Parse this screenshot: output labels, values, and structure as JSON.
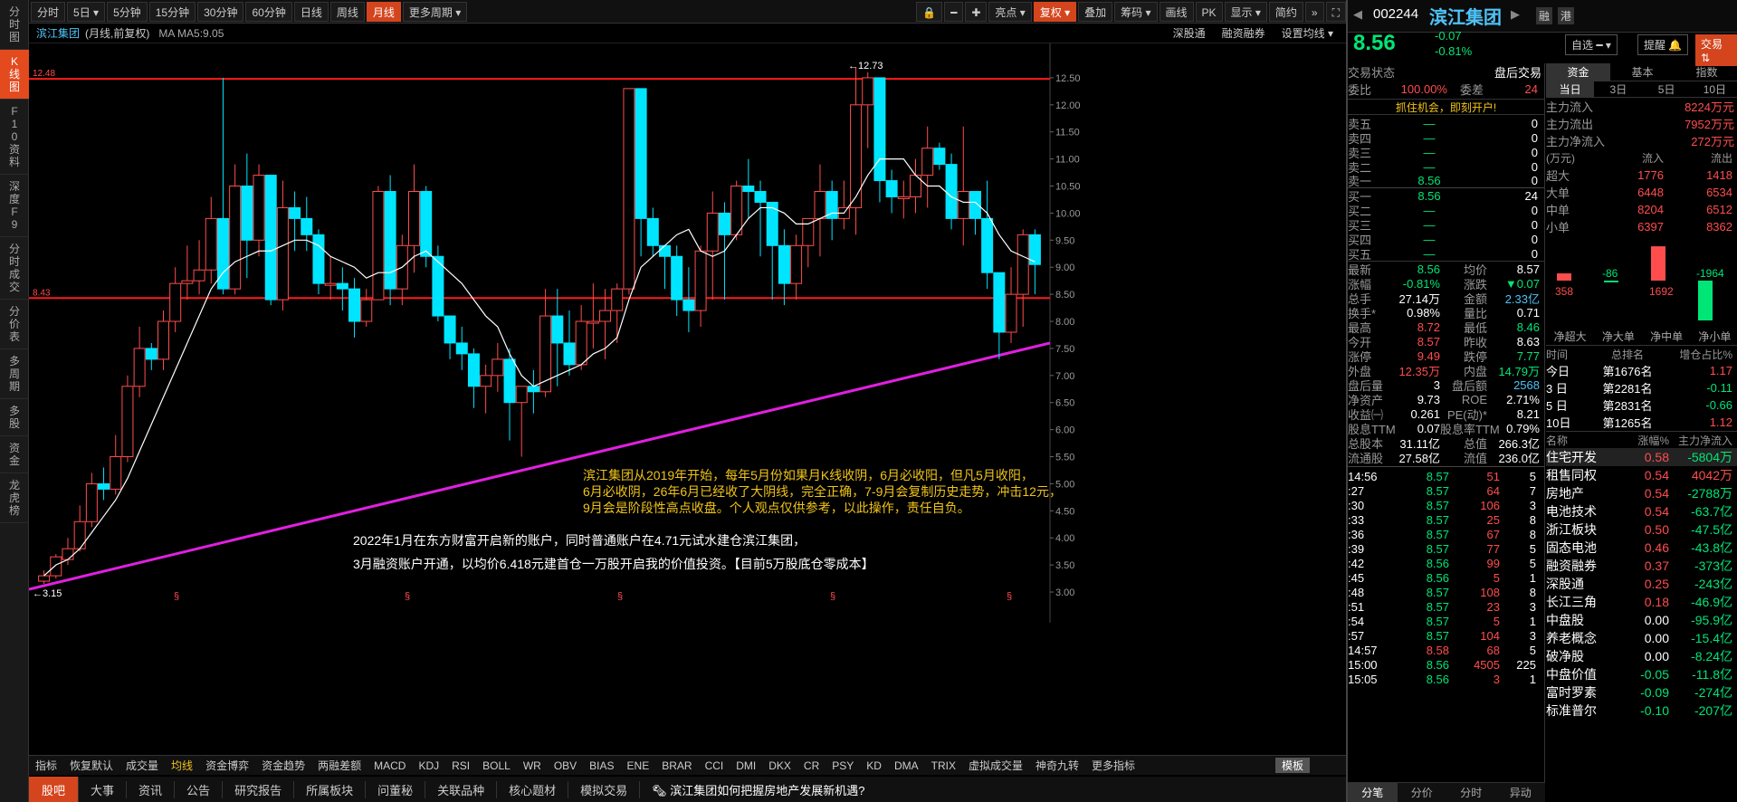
{
  "sidebar": [
    "分时图",
    "K线图",
    "F10资料",
    "深度F9",
    "分时成交",
    "分价表",
    "多周期",
    "多股",
    "资金",
    "龙虎榜"
  ],
  "toolbar": {
    "periods": [
      "分时",
      "5日",
      "5分钟",
      "15分钟",
      "30分钟",
      "60分钟",
      "日线",
      "周线",
      "月线",
      "更多周期"
    ],
    "right": [
      "亮点",
      "复权",
      "叠加",
      "筹码",
      "画线",
      "PK",
      "显示",
      "简约"
    ]
  },
  "sub": {
    "name": "滨江集团",
    "mode": "(月线,前复权)",
    "ma": "MA  MA5:9.05",
    "right": [
      "深股通",
      "融资融券",
      "设置均线"
    ]
  },
  "chart_data": {
    "type": "candlestick",
    "ylim": [
      2.9,
      12.9
    ],
    "yticks": [
      "12.50",
      "12.00",
      "11.50",
      "11.00",
      "10.50",
      "10.00",
      "9.50",
      "9.00",
      "8.50",
      "8.00",
      "7.50",
      "7.00",
      "6.50",
      "6.00",
      "5.50",
      "5.00",
      "4.50",
      "4.00",
      "3.50",
      "3.00"
    ],
    "hlines": [
      {
        "label": "12.48",
        "value": 12.48
      },
      {
        "label": "8.43",
        "value": 8.43
      }
    ],
    "marks": {
      "high": "12.73",
      "low": "3.15"
    },
    "candles": [
      [
        3.2,
        3.3,
        3.15,
        3.4
      ],
      [
        3.3,
        3.65,
        3.25,
        3.7
      ],
      [
        3.6,
        3.8,
        3.5,
        4.0
      ],
      [
        3.8,
        4.3,
        3.75,
        4.6
      ],
      [
        4.3,
        5.0,
        4.2,
        5.2
      ],
      [
        5.0,
        4.9,
        4.7,
        5.3
      ],
      [
        4.9,
        5.5,
        4.8,
        5.9
      ],
      [
        5.5,
        6.8,
        5.4,
        7.0
      ],
      [
        6.8,
        7.5,
        6.6,
        7.9
      ],
      [
        7.5,
        7.3,
        7.1,
        7.6
      ],
      [
        7.3,
        8.0,
        7.1,
        8.2
      ],
      [
        8.0,
        8.7,
        7.8,
        9.0
      ],
      [
        8.7,
        8.75,
        8.4,
        9.4
      ],
      [
        8.75,
        8.95,
        8.5,
        9.5
      ],
      [
        8.95,
        9.9,
        8.7,
        10.3
      ],
      [
        9.9,
        8.6,
        8.5,
        12.5
      ],
      [
        8.6,
        10.5,
        8.5,
        10.9
      ],
      [
        10.5,
        9.5,
        8.8,
        11.1
      ],
      [
        9.5,
        10.7,
        9.2,
        10.9
      ],
      [
        10.7,
        8.4,
        8.3,
        10.7
      ],
      [
        8.4,
        10.1,
        8.2,
        10.6
      ],
      [
        10.1,
        9.9,
        9.3,
        10.4
      ],
      [
        9.9,
        9.6,
        9.3,
        10.3
      ],
      [
        9.6,
        8.7,
        8.5,
        9.7
      ],
      [
        8.7,
        8.7,
        8.4,
        9.2
      ],
      [
        8.7,
        8.6,
        8.2,
        9.0
      ],
      [
        8.6,
        8.0,
        7.7,
        8.8
      ],
      [
        8.0,
        8.4,
        7.9,
        8.6
      ],
      [
        8.4,
        10.4,
        8.4,
        10.5
      ],
      [
        10.4,
        8.6,
        8.3,
        10.7
      ],
      [
        8.6,
        9.4,
        8.3,
        9.6
      ],
      [
        9.4,
        10.4,
        8.9,
        10.9
      ],
      [
        10.4,
        9.2,
        9.0,
        10.5
      ],
      [
        9.2,
        8.1,
        8.0,
        9.4
      ],
      [
        8.1,
        7.6,
        7.3,
        7.7
      ],
      [
        7.6,
        7.4,
        7.1,
        7.9
      ],
      [
        7.4,
        6.8,
        6.4,
        7.5
      ],
      [
        6.8,
        7.0,
        6.3,
        7.2
      ],
      [
        7.0,
        7.3,
        6.7,
        7.6
      ],
      [
        7.3,
        6.5,
        5.8,
        7.5
      ],
      [
        6.5,
        6.8,
        5.5,
        6.8
      ],
      [
        6.8,
        6.7,
        6.3,
        7.1
      ],
      [
        6.7,
        8.1,
        6.6,
        8.6
      ],
      [
        8.1,
        7.6,
        6.8,
        8.6
      ],
      [
        7.6,
        7.2,
        7.0,
        8.2
      ],
      [
        7.2,
        8.0,
        7.1,
        8.3
      ],
      [
        8.0,
        8.0,
        7.5,
        8.7
      ],
      [
        8.0,
        8.2,
        7.3,
        8.6
      ],
      [
        8.2,
        8.6,
        7.6,
        8.7
      ],
      [
        8.6,
        12.3,
        8.5,
        12.3
      ],
      [
        12.3,
        9.9,
        9.2,
        12.3
      ],
      [
        9.9,
        9.4,
        9.2,
        10.1
      ],
      [
        9.4,
        9.2,
        8.6,
        9.4
      ],
      [
        9.2,
        8.4,
        8.1,
        9.4
      ],
      [
        8.4,
        8.2,
        7.8,
        9.0
      ],
      [
        8.2,
        9.3,
        7.9,
        9.4
      ],
      [
        9.3,
        10.0,
        8.4,
        10.4
      ],
      [
        10.0,
        9.6,
        8.4,
        10.2
      ],
      [
        9.6,
        10.5,
        9.5,
        10.6
      ],
      [
        10.5,
        10.4,
        9.9,
        11.0
      ],
      [
        10.4,
        10.2,
        9.2,
        10.6
      ],
      [
        10.2,
        9.4,
        8.4,
        10.2
      ],
      [
        9.4,
        8.7,
        8.3,
        9.7
      ],
      [
        8.7,
        9.4,
        8.4,
        9.6
      ],
      [
        9.4,
        9.9,
        9.0,
        9.9
      ],
      [
        9.9,
        10.4,
        9.2,
        10.9
      ],
      [
        10.4,
        9.9,
        9.5,
        10.6
      ],
      [
        9.9,
        10.1,
        9.7,
        10.6
      ],
      [
        10.1,
        12.0,
        9.6,
        12.7
      ],
      [
        12.0,
        12.5,
        11.2,
        12.6
      ],
      [
        12.5,
        10.6,
        10.2,
        12.5
      ],
      [
        10.6,
        10.3,
        10.0,
        10.8
      ],
      [
        10.3,
        10.3,
        9.9,
        10.6
      ],
      [
        10.3,
        10.7,
        10.0,
        11.0
      ],
      [
        10.7,
        11.2,
        10.1,
        11.6
      ],
      [
        11.2,
        10.9,
        10.8,
        11.3
      ],
      [
        10.9,
        9.9,
        9.7,
        11.1
      ],
      [
        9.9,
        10.4,
        9.4,
        11.6
      ],
      [
        10.4,
        9.9,
        9.6,
        10.3
      ],
      [
        9.9,
        8.9,
        8.6,
        10.6
      ],
      [
        8.9,
        7.8,
        7.3,
        8.9
      ],
      [
        7.8,
        8.5,
        7.6,
        9.0
      ],
      [
        8.5,
        9.6,
        7.9,
        9.7
      ],
      [
        9.6,
        9.05,
        8.5,
        9.7
      ]
    ],
    "ma5": [
      3.3,
      3.5,
      3.6,
      3.8,
      4.1,
      4.4,
      4.7,
      5.1,
      5.6,
      6.1,
      6.6,
      7.1,
      7.6,
      8.1,
      8.6,
      8.9,
      9.1,
      9.2,
      9.3,
      9.3,
      9.4,
      9.5,
      9.5,
      9.4,
      9.2,
      9.1,
      9.0,
      8.8,
      8.9,
      8.9,
      9.0,
      9.2,
      9.3,
      9.1,
      8.9,
      8.7,
      8.4,
      8.1,
      7.9,
      7.4,
      7.0,
      6.8,
      6.9,
      7.0,
      7.1,
      7.2,
      7.4,
      7.5,
      7.7,
      8.4,
      9.0,
      9.2,
      9.4,
      9.6,
      9.7,
      9.3,
      9.2,
      9.3,
      9.6,
      9.9,
      10.1,
      10.1,
      10.0,
      9.8,
      9.8,
      9.9,
      10.0,
      10.0,
      10.3,
      10.7,
      11.0,
      11.0,
      11.0,
      10.7,
      10.5,
      10.5,
      10.3,
      10.2,
      10.2,
      10.0,
      9.6,
      9.3,
      9.2,
      9.1
    ]
  },
  "annotations": {
    "yellow": [
      "滨江集团从2019年开始，每年5月份如果月K线收阴，6月必收阳，但凡5月收阳，",
      "6月必收阴，26年6月已经收了大阴线，完全正确，7-9月会复制历史走势，冲击12元，",
      "9月会是阶段性高点收盘。个人观点仅供参考，以此操作，责任自负。"
    ],
    "white": [
      "2022年1月在东方财富开启新的账户，同时普通账户在4.71元试水建仓滨江集团，",
      "3月融资账户开通，以均价6.418元建首仓一万股开启我的价值投资。【目前5万股底仓零成本】"
    ]
  },
  "indicators": [
    "指标",
    "恢复默认",
    "成交量",
    "均线",
    "资金博弈",
    "资金趋势",
    "两融差额",
    "MACD",
    "KDJ",
    "RSI",
    "BOLL",
    "WR",
    "OBV",
    "BIAS",
    "ENE",
    "BRAR",
    "CCI",
    "DMI",
    "DKX",
    "CR",
    "PSY",
    "KD",
    "DMA",
    "TRIX",
    "虚拟成交量",
    "神奇九转",
    "更多指标",
    "模板"
  ],
  "bottom": [
    "股吧",
    "大事",
    "资讯",
    "公告",
    "研究报告",
    "所属板块",
    "问董秘",
    "关联品种",
    "核心题材",
    "模拟交易"
  ],
  "news": "滨江集团如何把握房地产发展新机遇?",
  "stock": {
    "code": "002244",
    "name": "滨江集团",
    "price": "8.56",
    "chg": "-0.07",
    "pct": "-0.81%",
    "btns": [
      "融",
      "港",
      "自选",
      "提醒",
      "交易"
    ]
  },
  "status": {
    "label": "交易状态",
    "value": "盘后交易",
    "wb": "委比",
    "wbv": "100.00%",
    "wc": "委差",
    "wcv": "24",
    "ad": "抓住机会，即刻开户!"
  },
  "book": [
    [
      "卖五",
      "—",
      "0"
    ],
    [
      "卖四",
      "—",
      "0"
    ],
    [
      "卖三",
      "—",
      "0"
    ],
    [
      "卖二",
      "—",
      "0"
    ],
    [
      "卖一",
      "8.56",
      "0"
    ],
    [
      "买一",
      "8.56",
      "24"
    ],
    [
      "买二",
      "—",
      "0"
    ],
    [
      "买三",
      "—",
      "0"
    ],
    [
      "买四",
      "—",
      "0"
    ],
    [
      "买五",
      "—",
      "0"
    ]
  ],
  "quote": [
    [
      "最新",
      "8.56",
      "均价",
      "8.57"
    ],
    [
      "涨幅",
      "-0.81%",
      "涨跌",
      "▼0.07"
    ],
    [
      "总手",
      "27.14万",
      "金额",
      "2.33亿"
    ],
    [
      "换手*",
      "0.98%",
      "量比",
      "0.71"
    ],
    [
      "最高",
      "8.72",
      "最低",
      "8.46"
    ],
    [
      "今开",
      "8.57",
      "昨收",
      "8.63"
    ],
    [
      "涨停",
      "9.49",
      "跌停",
      "7.77"
    ],
    [
      "外盘",
      "12.35万",
      "内盘",
      "14.79万"
    ],
    [
      "盘后量",
      "3",
      "盘后额",
      "2568"
    ],
    [
      "净资产",
      "9.73",
      "ROE",
      "2.71%"
    ],
    [
      "收益㈠",
      "0.261",
      "PE(动)*",
      "8.21"
    ],
    [
      "股息TTM",
      "0.07",
      "股息率TTM",
      "0.79%"
    ],
    [
      "总股本",
      "31.11亿",
      "总值",
      "266.3亿"
    ],
    [
      "流通股",
      "27.58亿",
      "流值",
      "236.0亿"
    ]
  ],
  "trades": [
    [
      "14:56",
      "8.57",
      "51",
      "5"
    ],
    [
      ":27",
      "8.57",
      "64",
      "7"
    ],
    [
      ":30",
      "8.57",
      "106",
      "3"
    ],
    [
      ":33",
      "8.57",
      "25",
      "8"
    ],
    [
      ":36",
      "8.57",
      "67",
      "8"
    ],
    [
      ":39",
      "8.57",
      "77",
      "5"
    ],
    [
      ":42",
      "8.56",
      "99",
      "5"
    ],
    [
      ":45",
      "8.56",
      "5",
      "1"
    ],
    [
      ":48",
      "8.57",
      "108",
      "8"
    ],
    [
      ":51",
      "8.57",
      "23",
      "3"
    ],
    [
      ":54",
      "8.57",
      "5",
      "1"
    ],
    [
      ":57",
      "8.57",
      "104",
      "3"
    ],
    [
      "14:57",
      "8.58",
      "68",
      "5"
    ],
    [
      "15:00",
      "8.56",
      "4505",
      "225"
    ],
    [
      "15:05",
      "8.56",
      "3",
      "1"
    ]
  ],
  "tabs_bottom": [
    "分笔",
    "分价",
    "分时",
    "异动"
  ],
  "fund": {
    "tabs": [
      "资金",
      "基本",
      "指数"
    ],
    "sub": [
      "当日",
      "3日",
      "5日",
      "10日"
    ],
    "flow": [
      [
        "主力流入",
        "8224万元"
      ],
      [
        "主力流出",
        "7952万元"
      ],
      [
        "主力净流入",
        "272万元"
      ]
    ],
    "unit": "(万元)",
    "in": "流入",
    "out": "流出",
    "types": [
      [
        "超大",
        "1776",
        "1418"
      ],
      [
        "大单",
        "6448",
        "6534"
      ],
      [
        "中单",
        "8204",
        "6512"
      ],
      [
        "小单",
        "6397",
        "8362"
      ]
    ],
    "bars": [
      "358",
      "-86",
      "1692",
      "-1964"
    ],
    "barl": [
      "净超大",
      "净大单",
      "净中单",
      "净小单"
    ]
  },
  "rank": {
    "hd": [
      "时间",
      "总排名",
      "增仓占比%"
    ],
    "rows": [
      [
        "今日",
        "第1676名",
        "1.17"
      ],
      [
        "3 日",
        "第2281名",
        "-0.11"
      ],
      [
        "5 日",
        "第2831名",
        "-0.66"
      ],
      [
        "10日",
        "第1265名",
        "1.12"
      ]
    ]
  },
  "sectors": {
    "hd": [
      "名称",
      "涨幅%",
      "主力净流入"
    ],
    "rows": [
      [
        "住宅开发",
        "0.58",
        "-5804万"
      ],
      [
        "租售同权",
        "0.54",
        "4042万"
      ],
      [
        "房地产",
        "0.54",
        "-2788万"
      ],
      [
        "电池技术",
        "0.54",
        "-63.7亿"
      ],
      [
        "浙江板块",
        "0.50",
        "-47.5亿"
      ],
      [
        "固态电池",
        "0.46",
        "-43.8亿"
      ],
      [
        "融资融券",
        "0.37",
        "-373亿"
      ],
      [
        "深股通",
        "0.25",
        "-243亿"
      ],
      [
        "长江三角",
        "0.18",
        "-46.9亿"
      ],
      [
        "中盘股",
        "0.00",
        "-95.9亿"
      ],
      [
        "养老概念",
        "0.00",
        "-15.4亿"
      ],
      [
        "破净股",
        "0.00",
        "-8.24亿"
      ],
      [
        "中盘价值",
        "-0.05",
        "-11.8亿"
      ],
      [
        "富时罗素",
        "-0.09",
        "-274亿"
      ],
      [
        "标准普尔",
        "-0.10",
        "-207亿"
      ]
    ]
  }
}
